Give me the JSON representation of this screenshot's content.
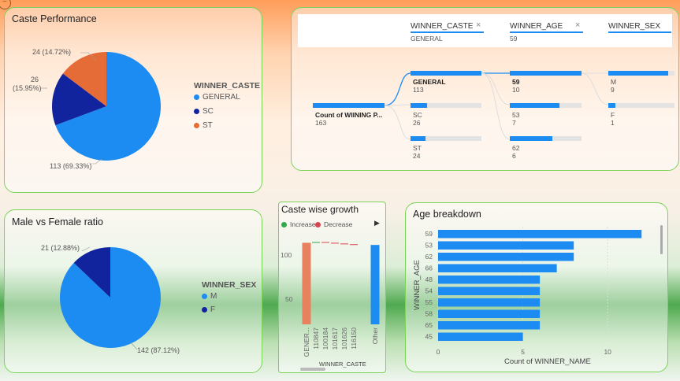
{
  "caste_performance": {
    "title": "Caste Performance",
    "legend_title": "WINNER_CASTE",
    "legend": [
      {
        "label": "GENERAL",
        "color": "#1c8cf2"
      },
      {
        "label": "SC",
        "color": "#12239e"
      },
      {
        "label": "ST",
        "color": "#e66c37"
      }
    ],
    "labels": {
      "st": "24 (14.72%)",
      "sc_value": "26",
      "sc_pct": "(15.95%)",
      "general": "113 (69.33%)"
    }
  },
  "decomposition": {
    "filters": [
      {
        "name": "WINNER_CASTE",
        "value": "GENERAL",
        "close_icon": "close-icon"
      },
      {
        "name": "WINNER_AGE",
        "value": "59",
        "close_icon": "close-icon"
      },
      {
        "name": "WINNER_SEX",
        "value": ""
      }
    ],
    "root": {
      "label": "Count of WIINING  P...",
      "value": "163"
    },
    "caste": [
      {
        "label": "GENERAL",
        "value": "113"
      },
      {
        "label": "SC",
        "value": "26"
      },
      {
        "label": "ST",
        "value": "24"
      }
    ],
    "age": [
      {
        "label": "59",
        "value": "10"
      },
      {
        "label": "53",
        "value": "7"
      },
      {
        "label": "62",
        "value": "6"
      }
    ],
    "sex": [
      {
        "label": "M",
        "value": "9"
      },
      {
        "label": "F",
        "value": "1"
      }
    ]
  },
  "sex_ratio": {
    "title": "Male vs Female ratio",
    "legend_title": "WINNER_SEX",
    "legend": [
      {
        "label": "M",
        "color": "#1c8cf2"
      },
      {
        "label": "F",
        "color": "#12239e"
      }
    ],
    "labels": {
      "f": "21 (12.88%)",
      "m": "142 (87.12%)"
    }
  },
  "caste_growth": {
    "title": "Caste wise growth",
    "legend_increase": "Increase",
    "legend_decrease": "Decrease",
    "increase_color": "#2eaa4a",
    "decrease_color": "#d64550",
    "xlabel": "WINNER_CASTE",
    "y_ticks": [
      "100",
      "50"
    ]
  },
  "age_breakdown": {
    "title": "Age breakdown",
    "ylabel": "WINNER_AGE",
    "xlabel": "Count of WINNER_NAME",
    "x_ticks": [
      "0",
      "5",
      "10"
    ]
  },
  "chart_data": [
    {
      "type": "pie",
      "title": "Caste Performance",
      "legend_title": "WINNER_CASTE",
      "categories": [
        "GENERAL",
        "SC",
        "ST"
      ],
      "values": [
        113,
        26,
        24
      ],
      "percents": [
        69.33,
        15.95,
        14.72
      ],
      "colors": [
        "#1c8cf2",
        "#12239e",
        "#e66c37"
      ]
    },
    {
      "type": "pie",
      "title": "Male vs Female ratio",
      "legend_title": "WINNER_SEX",
      "categories": [
        "M",
        "F"
      ],
      "values": [
        142,
        21
      ],
      "percents": [
        87.12,
        12.88
      ],
      "colors": [
        "#1c8cf2",
        "#12239e"
      ]
    },
    {
      "type": "bar",
      "title": "Caste wise growth",
      "xlabel": "WINNER_CASTE",
      "categories": [
        "GENER...",
        "110847",
        "100184",
        "101617",
        "101626",
        "116150",
        "Other"
      ],
      "values": [
        113,
        1,
        -1,
        -1,
        -1,
        -1,
        110
      ],
      "ylim": [
        0,
        120
      ],
      "y_ticks": [
        50,
        100
      ]
    },
    {
      "type": "bar",
      "orientation": "horizontal",
      "title": "Age breakdown",
      "ylabel": "WINNER_AGE",
      "xlabel": "Count of WINNER_NAME",
      "categories": [
        "59",
        "53",
        "62",
        "66",
        "48",
        "54",
        "55",
        "58",
        "65",
        "45"
      ],
      "values": [
        12,
        8,
        8,
        7,
        6,
        6,
        6,
        6,
        6,
        5
      ],
      "xlim": [
        0,
        12.5
      ],
      "x_ticks": [
        0,
        5,
        10
      ]
    }
  ]
}
